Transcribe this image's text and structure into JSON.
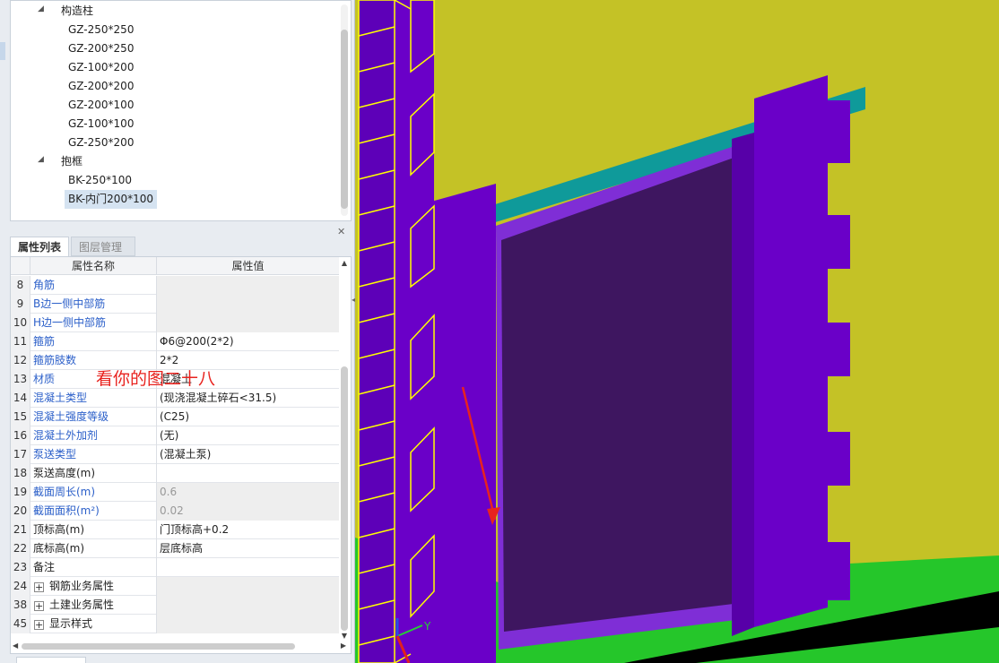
{
  "tree": {
    "groups": [
      {
        "label": "构造柱",
        "items": [
          "GZ-250*250",
          "GZ-200*250",
          "GZ-100*200",
          "GZ-200*200",
          "GZ-200*100",
          "GZ-100*100",
          "GZ-250*200"
        ]
      },
      {
        "label": "抱框",
        "items": [
          "BK-250*100",
          "BK-内门200*100"
        ]
      }
    ],
    "selected": "BK-内门200*100"
  },
  "tabs": [
    {
      "label": "属性列表",
      "active": true
    },
    {
      "label": "图层管理",
      "active": false
    }
  ],
  "grid": {
    "headers": [
      "属性名称",
      "属性值"
    ],
    "rows": [
      {
        "num": "8",
        "name": "角筋",
        "value": "",
        "style": "blue"
      },
      {
        "num": "9",
        "name": "B边一侧中部筋",
        "value": "",
        "style": "blue"
      },
      {
        "num": "10",
        "name": "H边一侧中部筋",
        "value": "",
        "style": "blue"
      },
      {
        "num": "11",
        "name": "箍筋",
        "value": "Φ6@200(2*2)",
        "style": "blue"
      },
      {
        "num": "12",
        "name": "箍筋肢数",
        "value": "2*2",
        "style": "blue"
      },
      {
        "num": "13",
        "name": "材质",
        "value": "混凝土",
        "style": "blue"
      },
      {
        "num": "14",
        "name": "混凝土类型",
        "value": "(现浇混凝土碎石<31.5)",
        "style": "blue"
      },
      {
        "num": "15",
        "name": "混凝土强度等级",
        "value": "(C25)",
        "style": "blue"
      },
      {
        "num": "16",
        "name": "混凝土外加剂",
        "value": "(无)",
        "style": "blue"
      },
      {
        "num": "17",
        "name": "泵送类型",
        "value": "(混凝土泵)",
        "style": "blue"
      },
      {
        "num": "18",
        "name": "泵送高度(m)",
        "value": "",
        "style": "dark"
      },
      {
        "num": "19",
        "name": "截面周长(m)",
        "value": "0.6",
        "style": "blue-gray"
      },
      {
        "num": "20",
        "name": "截面面积(m²)",
        "value": "0.02",
        "style": "blue-gray"
      },
      {
        "num": "21",
        "name": "顶标高(m)",
        "value": "门顶标高+0.2",
        "style": "dark"
      },
      {
        "num": "22",
        "name": "底标高(m)",
        "value": "层底标高",
        "style": "dark"
      },
      {
        "num": "23",
        "name": "备注",
        "value": "",
        "style": "dark"
      },
      {
        "num": "24",
        "name": "钢筋业务属性",
        "value": "",
        "style": "group"
      },
      {
        "num": "38",
        "name": "土建业务属性",
        "value": "",
        "style": "group"
      },
      {
        "num": "45",
        "name": "显示样式",
        "value": "",
        "style": "group"
      }
    ]
  },
  "annotation": "看你的图二十八",
  "axis": {
    "y_label": "Y"
  },
  "colors": {
    "wall": "#c4c226",
    "column": "#6a00c8",
    "door": "#3e1660",
    "door_frame": "#7f2ed6",
    "beam": "#0f9a9a",
    "ground": "#25c62a",
    "wireframe": "#ffff00",
    "annotation": "#e8231f"
  }
}
